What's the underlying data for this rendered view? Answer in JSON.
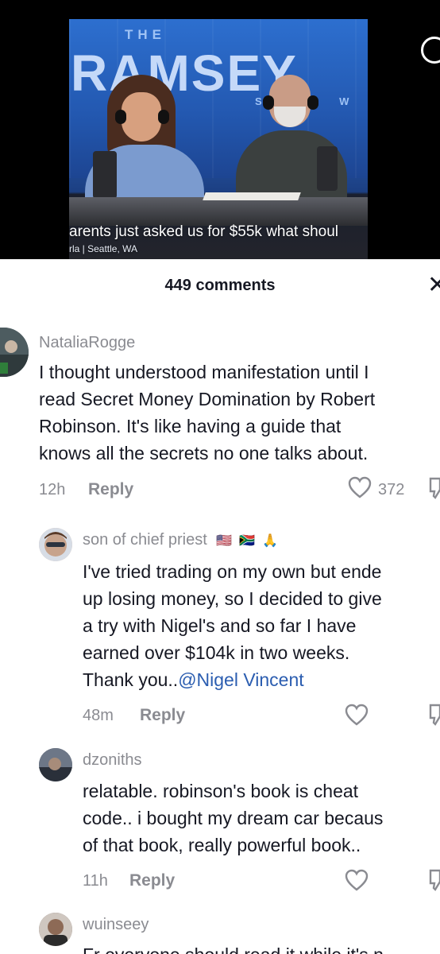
{
  "video": {
    "brand_the": "THE",
    "brand_name": "RAMSEY",
    "brand_show": "SHOW",
    "caption_line1": "arents just asked us for $55k what shoul",
    "caption_line2": "rla | Seattle, WA"
  },
  "header": {
    "comments_count": "449 comments",
    "close_glyph": "✕"
  },
  "comments": [
    {
      "username": "NataliaRogge",
      "text": "I thought understood manifestation until I\nread Secret Money Domination by Robert\nRobinson. It's like having a guide that\nknows all the secrets no one talks about.",
      "time": "12h",
      "reply_label": "Reply",
      "likes": "372",
      "avatar_color": "#5a6a6e"
    },
    {
      "username": "son of chief priest",
      "username_emoji": "🇺🇸 🇿🇦 🙏",
      "text": "I've tried trading on my own but ende\nup losing money, so I decided to give\na try with Nigel's and so far I have\nearned over $104k in two weeks.\nThank you..",
      "mention": "@Nigel Vincent",
      "time": "48m",
      "reply_label": "Reply",
      "likes": "",
      "avatar_color": "#c7a38c"
    },
    {
      "username": "dzoniths",
      "text": "relatable. robinson's book is cheat\ncode.. i bought my dream car becaus\nof that book, really powerful book..",
      "time": "11h",
      "reply_label": "Reply",
      "likes": "",
      "avatar_color": "#3d4654"
    },
    {
      "username": "wuinseey",
      "text": "Fr everyone should read it while it's n",
      "time": "",
      "reply_label": "",
      "likes": "",
      "avatar_color": "#6b5a52"
    }
  ],
  "colors": {
    "text_primary": "#161823",
    "text_secondary": "#8a8b91",
    "mention": "#2b5db0"
  }
}
